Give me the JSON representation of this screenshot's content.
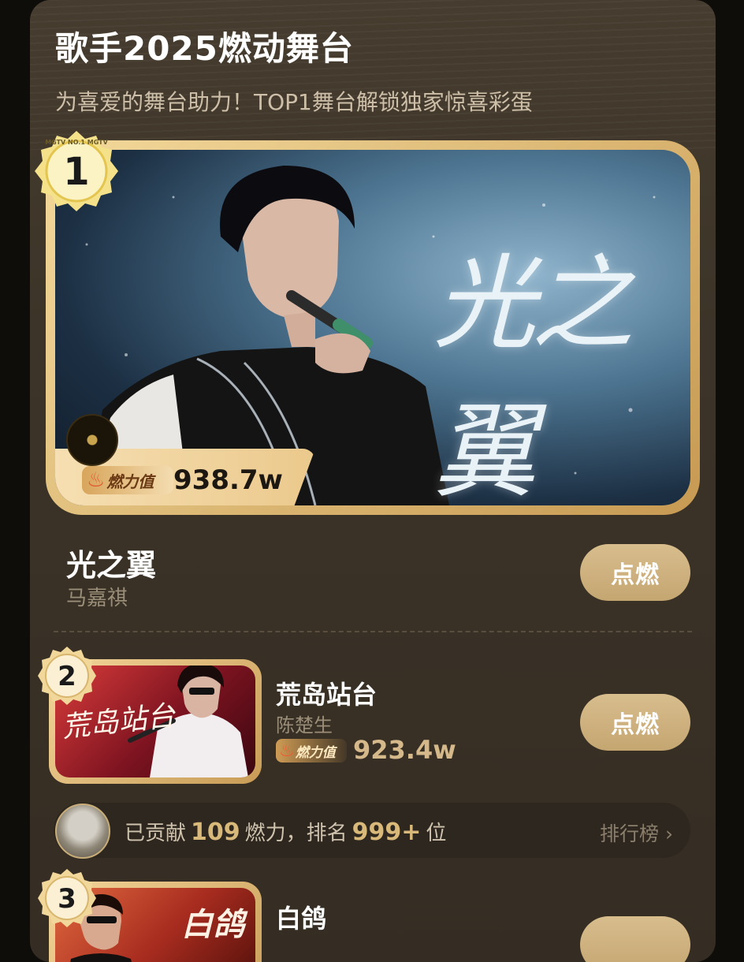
{
  "header": {
    "title": "歌手2025燃动舞台",
    "subtitle": "为喜爱的舞台助力！TOP1舞台解锁独家惊喜彩蛋"
  },
  "ranks": [
    {
      "rank": "1",
      "song": "光之翼",
      "artist": "马嘉祺",
      "score": "938.7w",
      "image_text": "光之翼",
      "badge_label": "燃力值",
      "medal_ring_text": "MGTV NO.1 MGTV",
      "button": "点燃"
    },
    {
      "rank": "2",
      "song": "荒岛站台",
      "artist": "陈楚生",
      "score": "923.4w",
      "image_text": "荒岛站台",
      "badge_label": "燃力值",
      "button": "点燃"
    },
    {
      "rank": "3",
      "song": "白鸽",
      "image_text": "白鸽"
    }
  ],
  "contribution": {
    "prefix": "已贡献",
    "amount": "109",
    "middle": "燃力，排名",
    "rank": "999+",
    "suffix": "位",
    "link": "排行榜",
    "link_chevron": "›"
  },
  "colors": {
    "card_bg": "#3c3428",
    "gold": "#d9b979",
    "button_bg": "#c9ad78"
  },
  "icons": [
    "flame-icon",
    "vinyl-disc-icon",
    "chevron-right-icon",
    "rank-medal-icon",
    "user-avatar"
  ]
}
